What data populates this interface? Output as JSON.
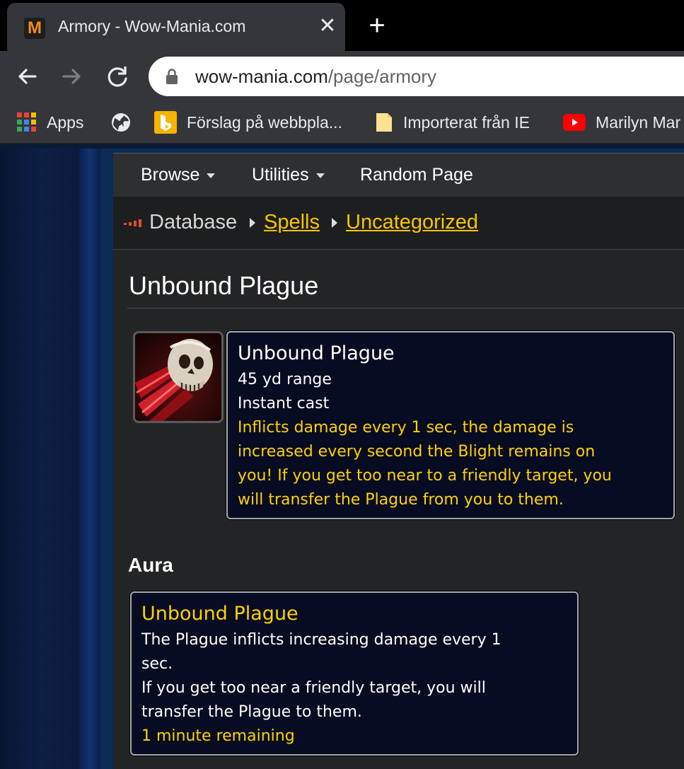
{
  "browser": {
    "tab": {
      "title": "Armory - Wow-Mania.com",
      "favicon_letter": "M"
    },
    "url": {
      "host": "wow-mania.com",
      "path": "/page/armory"
    },
    "bookmarks": [
      {
        "label": "Apps",
        "icon": "apps-grid-icon"
      },
      {
        "label": "",
        "icon": "globe-icon"
      },
      {
        "label": "Förslag på webbpla...",
        "icon": "bing-icon"
      },
      {
        "label": "Importerat från IE",
        "icon": "folder-icon"
      },
      {
        "label": "Marilyn Mar",
        "icon": "youtube-icon"
      }
    ]
  },
  "nav": {
    "browse": "Browse",
    "utilities": "Utilities",
    "random": "Random Page"
  },
  "breadcrumb": {
    "root": "Database",
    "level1": "Spells",
    "level2": "Uncategorized"
  },
  "spell": {
    "title": "Unbound Plague",
    "tooltip": {
      "name": "Unbound Plague",
      "range": "45 yd range",
      "cast": "Instant cast",
      "description_lines": [
        "Inflicts damage every 1 sec, the damage is",
        "increased every second the Blight remains on",
        "you! If you get too near to a friendly target, you",
        "will transfer the Plague from you to them."
      ]
    }
  },
  "aura": {
    "heading": "Aura",
    "name": "Unbound Plague",
    "lines": [
      "The Plague inflicts increasing damage every 1",
      "sec.",
      "If you get too near a friendly target, you will",
      "transfer the Plague to them."
    ],
    "remaining": "1 minute remaining"
  },
  "colors": {
    "accent_yellow": "#ffd100",
    "tooltip_bg": "#070c22",
    "link_yellow": "#f8c300"
  }
}
